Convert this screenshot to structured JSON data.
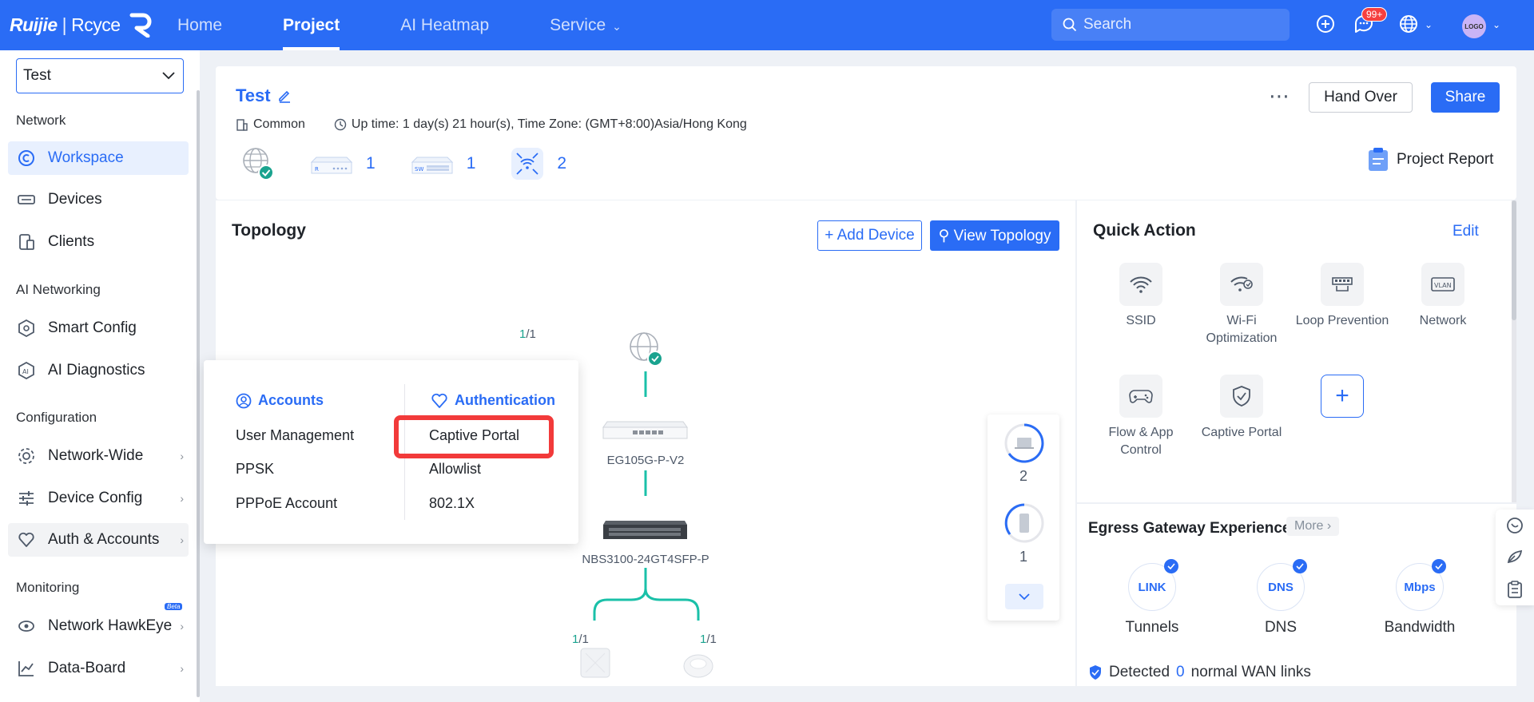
{
  "brand": {
    "name": "Ruijie",
    "sub": "Rcyce"
  },
  "nav": {
    "items": [
      {
        "label": "Home",
        "active": false
      },
      {
        "label": "Project",
        "active": true
      },
      {
        "label": "AI Heatmap",
        "active": false
      },
      {
        "label": "Service",
        "active": false,
        "dropdown": true
      }
    ]
  },
  "search": {
    "placeholder": "Search"
  },
  "toolbar": {
    "notification_badge": "99+",
    "avatar_text": "LOGO"
  },
  "sidebar": {
    "project_selector": "Test",
    "sections": {
      "network": "Network",
      "ai_networking": "AI Networking",
      "configuration": "Configuration",
      "monitoring": "Monitoring"
    },
    "items": {
      "workspace": "Workspace",
      "devices": "Devices",
      "clients": "Clients",
      "smart_config": "Smart Config",
      "ai_diagnostics": "AI Diagnostics",
      "network_wide": "Network-Wide",
      "device_config": "Device Config",
      "auth_accounts": "Auth & Accounts",
      "network_hawkeye": "Network HawkEye",
      "network_hawkeye_badge": "Beta",
      "data_board": "Data-Board"
    }
  },
  "project": {
    "name": "Test",
    "type": "Common",
    "uptime": "Up time: 1 day(s) 21 hour(s), Time Zone: (GMT+8:00)Asia/Hong Kong",
    "device_counts": {
      "router": "1",
      "switch": "1",
      "ap": "2"
    },
    "router_tag": "R",
    "switch_tag": "SW",
    "hand_over": "Hand Over",
    "share": "Share",
    "report": "Project Report"
  },
  "topology": {
    "title": "Topology",
    "add_device": "Add Device",
    "view_topology": "View Topology",
    "gateway_label": "EG105G-P-V2",
    "switch_label": "NBS3100-24GT4SFP-P",
    "port_up": "1",
    "port_total": "/1",
    "wired_clients": "2",
    "wireless_clients": "1"
  },
  "quick_action": {
    "title": "Quick Action",
    "edit": "Edit",
    "items": {
      "ssid": "SSID",
      "wifi_opt": "Wi-Fi Optimization",
      "loop": "Loop Prevention",
      "network": "Network",
      "vlan_tag": "VLAN",
      "flow": "Flow & App Control",
      "captive": "Captive Portal"
    }
  },
  "egress": {
    "title": "Egress Gateway Experience",
    "more": "More",
    "tunnels": "Tunnels",
    "tunnels_icon": "LINK",
    "dns": "DNS",
    "dns_icon": "DNS",
    "bandwidth": "Bandwidth",
    "bandwidth_icon": "Mbps",
    "detected_prefix": "Detected",
    "detected_count": "0",
    "detected_suffix": "normal WAN links"
  },
  "popup": {
    "accounts_title": "Accounts",
    "auth_title": "Authentication",
    "user_management": "User Management",
    "ppsk": "PPSK",
    "pppoe": "PPPoE Account",
    "captive_portal": "Captive Portal",
    "allowlist": "Allowlist",
    "dot1x": "802.1X"
  },
  "colors": {
    "primary": "#2a6cf5",
    "link_green": "#1aa38f",
    "highlight": "#f23a3a"
  }
}
